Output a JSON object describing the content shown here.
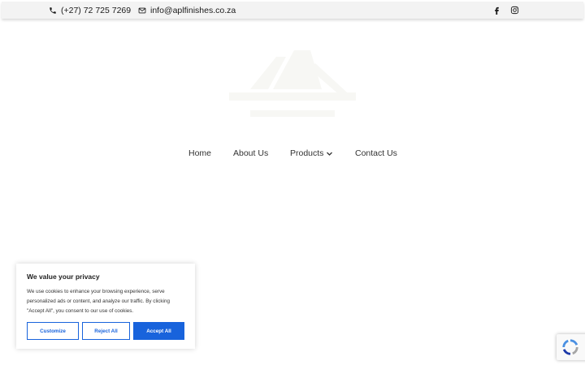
{
  "topbar": {
    "phone": "(+27) 72 725 7269",
    "email": "info@aplfinishes.co.za"
  },
  "icons": {
    "phone": "phone-icon",
    "email": "envelope-icon",
    "facebook": "facebook-icon",
    "instagram": "instagram-icon",
    "products_caret": "chevron-down-icon",
    "recaptcha": "recaptcha-icon"
  },
  "nav": {
    "home": "Home",
    "about": "About Us",
    "products": "Products",
    "contact": "Contact Us"
  },
  "cookie_banner": {
    "title": "We value your privacy",
    "text": "We use cookies to enhance your browsing experience, serve personalized ads or content, and analyze our traffic. By clicking \"Accept All\", you consent to our use of cookies.",
    "customize": "Customize",
    "reject": "Reject All",
    "accept": "Accept All"
  },
  "colors": {
    "topbar_bg": "#f3f3f3",
    "cookie_accent": "#1863dc"
  }
}
